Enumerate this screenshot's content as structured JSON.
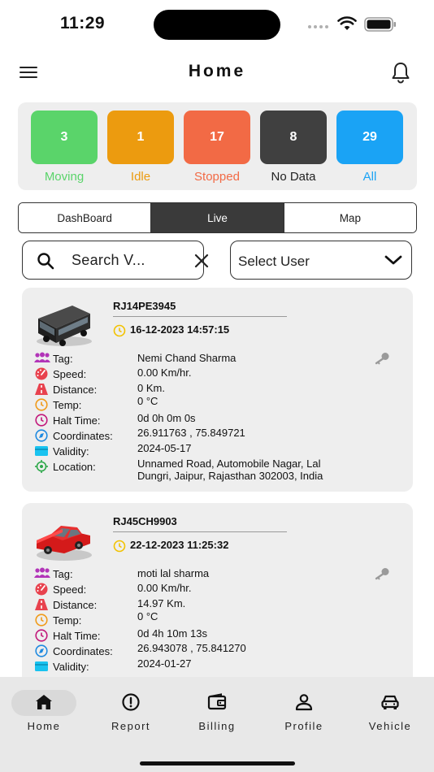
{
  "status_bar": {
    "time": "11:29"
  },
  "header": {
    "title": "Home"
  },
  "stats": [
    {
      "count": "3",
      "label": "Moving",
      "color": "#5ad46a",
      "label_color": "#5ad46a"
    },
    {
      "count": "1",
      "label": "Idle",
      "color": "#ec9b0f",
      "label_color": "#ec9b0f"
    },
    {
      "count": "17",
      "label": "Stopped",
      "color": "#f26a45",
      "label_color": "#f26a45"
    },
    {
      "count": "8",
      "label": "No Data",
      "color": "#404040",
      "label_color": "#222222"
    },
    {
      "count": "29",
      "label": "All",
      "color": "#1aa3f5",
      "label_color": "#1aa3f5"
    }
  ],
  "tabs": [
    {
      "label": "DashBoard",
      "active": false
    },
    {
      "label": "Live",
      "active": true
    },
    {
      "label": "Map",
      "active": false
    }
  ],
  "search": {
    "value": "Search V..."
  },
  "select_user": {
    "value": "Select User"
  },
  "field_labels": {
    "tag": "Tag:",
    "speed": "Speed:",
    "distance": "Distance:",
    "temp": "Temp:",
    "halt": "Halt Time:",
    "coords": "Coordinates:",
    "validity": "Validity:",
    "location": "Location:"
  },
  "vehicles": [
    {
      "reg": "RJ14PE3945",
      "datetime": "16-12-2023 14:57:15",
      "vehicle_icon": "bus-icon",
      "tag": "Nemi Chand Sharma",
      "speed": "0.00 Km/hr.",
      "distance": "0 Km.",
      "temp": "0 °C",
      "halt": "0d 0h 0m 0s",
      "coords": "26.911763 , 75.849721",
      "validity": "2024-05-17",
      "location": "Unnamed Road, Automobile Nagar, Lal Dungri, Jaipur, Rajasthan 302003, India"
    },
    {
      "reg": "RJ45CH9903",
      "datetime": "22-12-2023 11:25:32",
      "vehicle_icon": "car-icon",
      "tag": "moti lal sharma",
      "speed": "0.00 Km/hr.",
      "distance": "14.97 Km.",
      "temp": "0 °C",
      "halt": "0d 4h 10m 13s",
      "coords": "26.943078 , 75.841270",
      "validity": "2024-01-27",
      "location": ""
    }
  ],
  "bottom_nav": [
    {
      "label": "Home",
      "icon": "home-icon",
      "active": true
    },
    {
      "label": "Report",
      "icon": "alert-circle-icon",
      "active": false
    },
    {
      "label": "Billing",
      "icon": "wallet-icon",
      "active": false
    },
    {
      "label": "Profile",
      "icon": "person-icon",
      "active": false
    },
    {
      "label": "Vehicle",
      "icon": "car-front-icon",
      "active": false
    }
  ]
}
